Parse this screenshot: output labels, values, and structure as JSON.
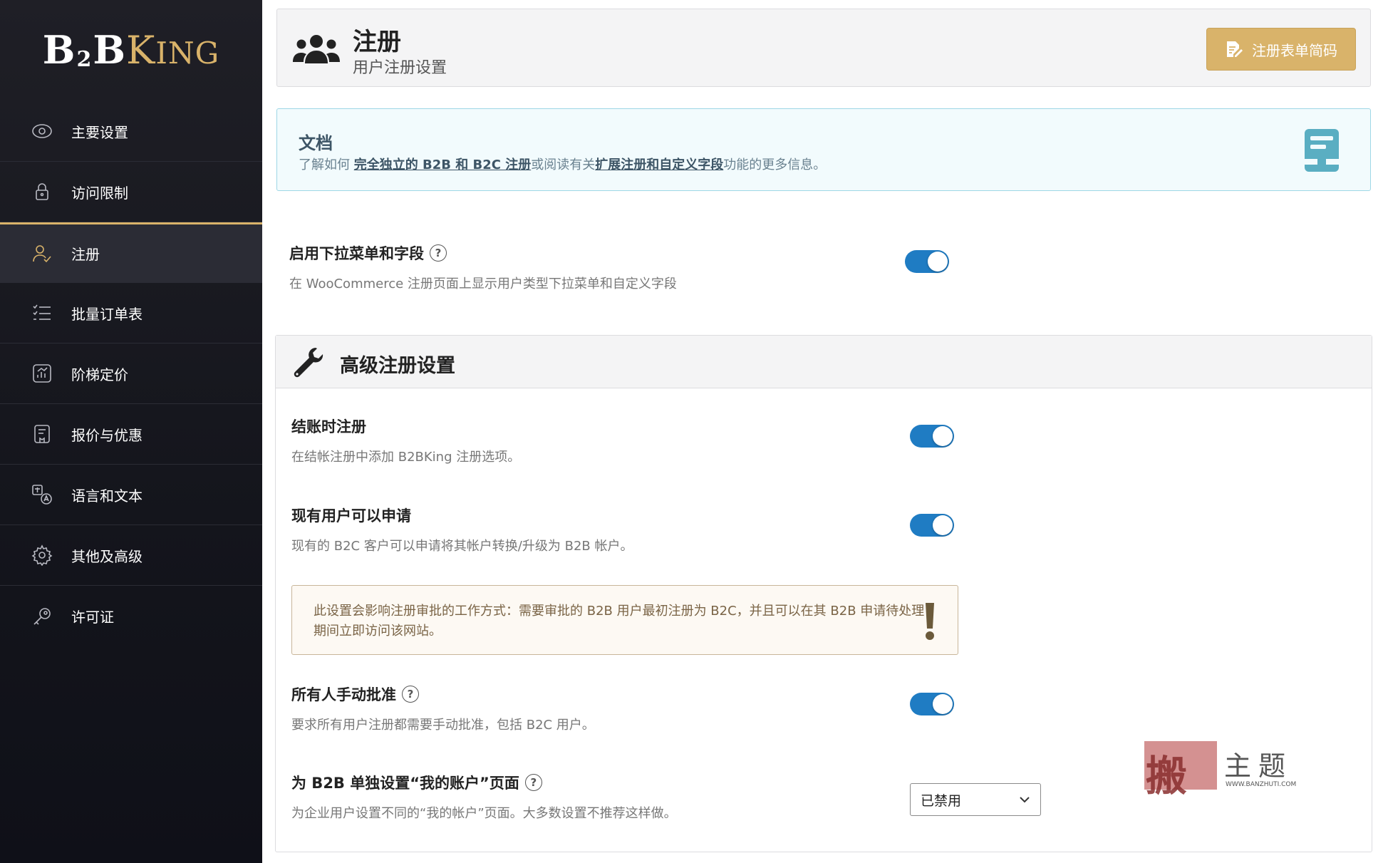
{
  "brand": {
    "b": "B",
    "two": "2",
    "b2": "B",
    "k": "K",
    "ing": "ING"
  },
  "sidebar": {
    "items": [
      {
        "label": "主要设置",
        "icon": "eye-icon"
      },
      {
        "label": "访问限制",
        "icon": "lock-icon"
      },
      {
        "label": "注册",
        "icon": "user-check-icon"
      },
      {
        "label": "批量订单表",
        "icon": "list-icon"
      },
      {
        "label": "阶梯定价",
        "icon": "chart-icon"
      },
      {
        "label": "报价与优惠",
        "icon": "document-icon"
      },
      {
        "label": "语言和文本",
        "icon": "translate-icon"
      },
      {
        "label": "其他及高级",
        "icon": "gear-icon"
      },
      {
        "label": "许可证",
        "icon": "key-icon"
      }
    ],
    "active_index": 2
  },
  "header": {
    "title": "注册",
    "subtitle": "用户注册设置",
    "shortcode_button": "注册表单简码"
  },
  "docs": {
    "title": "文档",
    "text_1": "了解如何 ",
    "link_1": "完全独立的 B2B 和 B2C 注册",
    "text_2": "或阅读有关",
    "link_2": "扩展注册和自定义字段",
    "text_3": "功能的更多信息。"
  },
  "dropdown_setting": {
    "title": "启用下拉菜单和字段",
    "desc": "在 WooCommerce 注册页面上显示用户类型下拉菜单和自定义字段",
    "enabled": true
  },
  "advanced": {
    "title": "高级注册设置",
    "checkout": {
      "title": "结账时注册",
      "desc": "在结帐注册中添加 B2BKing 注册选项。",
      "enabled": true
    },
    "existing_users": {
      "title": "现有用户可以申请",
      "desc": "现有的 B2C 客户可以申请将其帐户转换/升级为 B2B 帐户。",
      "enabled": true
    },
    "warning": "此设置会影响注册审批的工作方式：需要审批的 B2B 用户最初注册为 B2C，并且可以在其 B2B 申请待处理期间立即访问该网站。",
    "manual_approval": {
      "title": "所有人手动批准",
      "desc": "要求所有用户注册都需要手动批准，包括 B2C 用户。",
      "enabled": true
    },
    "my_account": {
      "title": "为 B2B 单独设置“我的账户”页面",
      "desc": "为企业用户设置不同的“我的帐户”页面。大多数设置不推荐这样做。",
      "selected": "已禁用"
    }
  },
  "watermark": {
    "char": "搬",
    "text": "主题",
    "url": "WWW.BANZHUTI.COM"
  },
  "colors": {
    "accent": "#d9b36a",
    "toggle_on": "#1f7cc3",
    "sidebar_bg": "#1a1b22",
    "doc_border": "#9ed7e6"
  }
}
